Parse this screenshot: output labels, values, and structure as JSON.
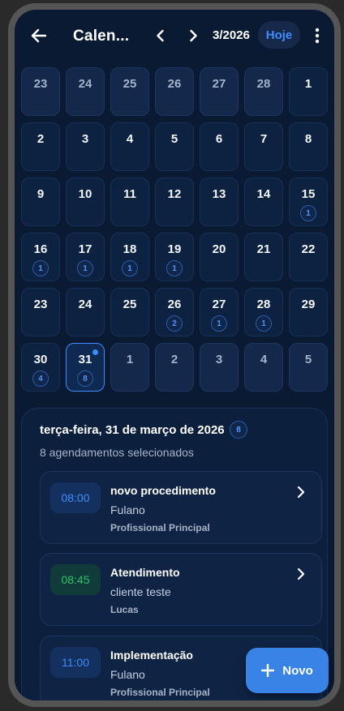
{
  "header": {
    "title": "Calen...",
    "month": "3/2026",
    "today_label": "Hoje"
  },
  "calendar": {
    "weeks": [
      [
        {
          "n": "23",
          "other": true
        },
        {
          "n": "24",
          "other": true
        },
        {
          "n": "25",
          "other": true
        },
        {
          "n": "26",
          "other": true
        },
        {
          "n": "27",
          "other": true
        },
        {
          "n": "28",
          "other": true
        },
        {
          "n": "1"
        }
      ],
      [
        {
          "n": "2"
        },
        {
          "n": "3"
        },
        {
          "n": "4"
        },
        {
          "n": "5"
        },
        {
          "n": "6"
        },
        {
          "n": "7"
        },
        {
          "n": "8"
        }
      ],
      [
        {
          "n": "9"
        },
        {
          "n": "10"
        },
        {
          "n": "11"
        },
        {
          "n": "12"
        },
        {
          "n": "13"
        },
        {
          "n": "14"
        },
        {
          "n": "15",
          "badge": "1"
        }
      ],
      [
        {
          "n": "16",
          "badge": "1"
        },
        {
          "n": "17",
          "badge": "1"
        },
        {
          "n": "18",
          "badge": "1"
        },
        {
          "n": "19",
          "badge": "1"
        },
        {
          "n": "20"
        },
        {
          "n": "21"
        },
        {
          "n": "22"
        }
      ],
      [
        {
          "n": "23"
        },
        {
          "n": "24"
        },
        {
          "n": "25"
        },
        {
          "n": "26",
          "badge": "2"
        },
        {
          "n": "27",
          "badge": "1"
        },
        {
          "n": "28",
          "badge": "1"
        },
        {
          "n": "29"
        }
      ],
      [
        {
          "n": "30",
          "badge": "4"
        },
        {
          "n": "31",
          "badge": "8",
          "selected": true
        },
        {
          "n": "1",
          "other": true
        },
        {
          "n": "2",
          "other": true
        },
        {
          "n": "3",
          "other": true
        },
        {
          "n": "4",
          "other": true
        },
        {
          "n": "5",
          "other": true
        }
      ]
    ]
  },
  "selected_day": {
    "date_label": "terça-feira, 31 de março de 2026",
    "count": "8",
    "subtitle": "8 agendamentos selecionados"
  },
  "appointments": [
    {
      "time": "08:00",
      "title": "novo procedimento",
      "client": "Fulano",
      "professional": "Profissional Principal",
      "color": "blue"
    },
    {
      "time": "08:45",
      "title": "Atendimento",
      "client": "cliente teste",
      "professional": "Lucas",
      "color": "green"
    },
    {
      "time": "11:00",
      "title": "Implementação",
      "client": "Fulano",
      "professional": "Profissional Principal",
      "color": "blue"
    }
  ],
  "fab": {
    "label": "Novo"
  },
  "colors": {
    "accent": "#3e8cff",
    "background": "#0a1a33",
    "success": "#2bc46a"
  }
}
